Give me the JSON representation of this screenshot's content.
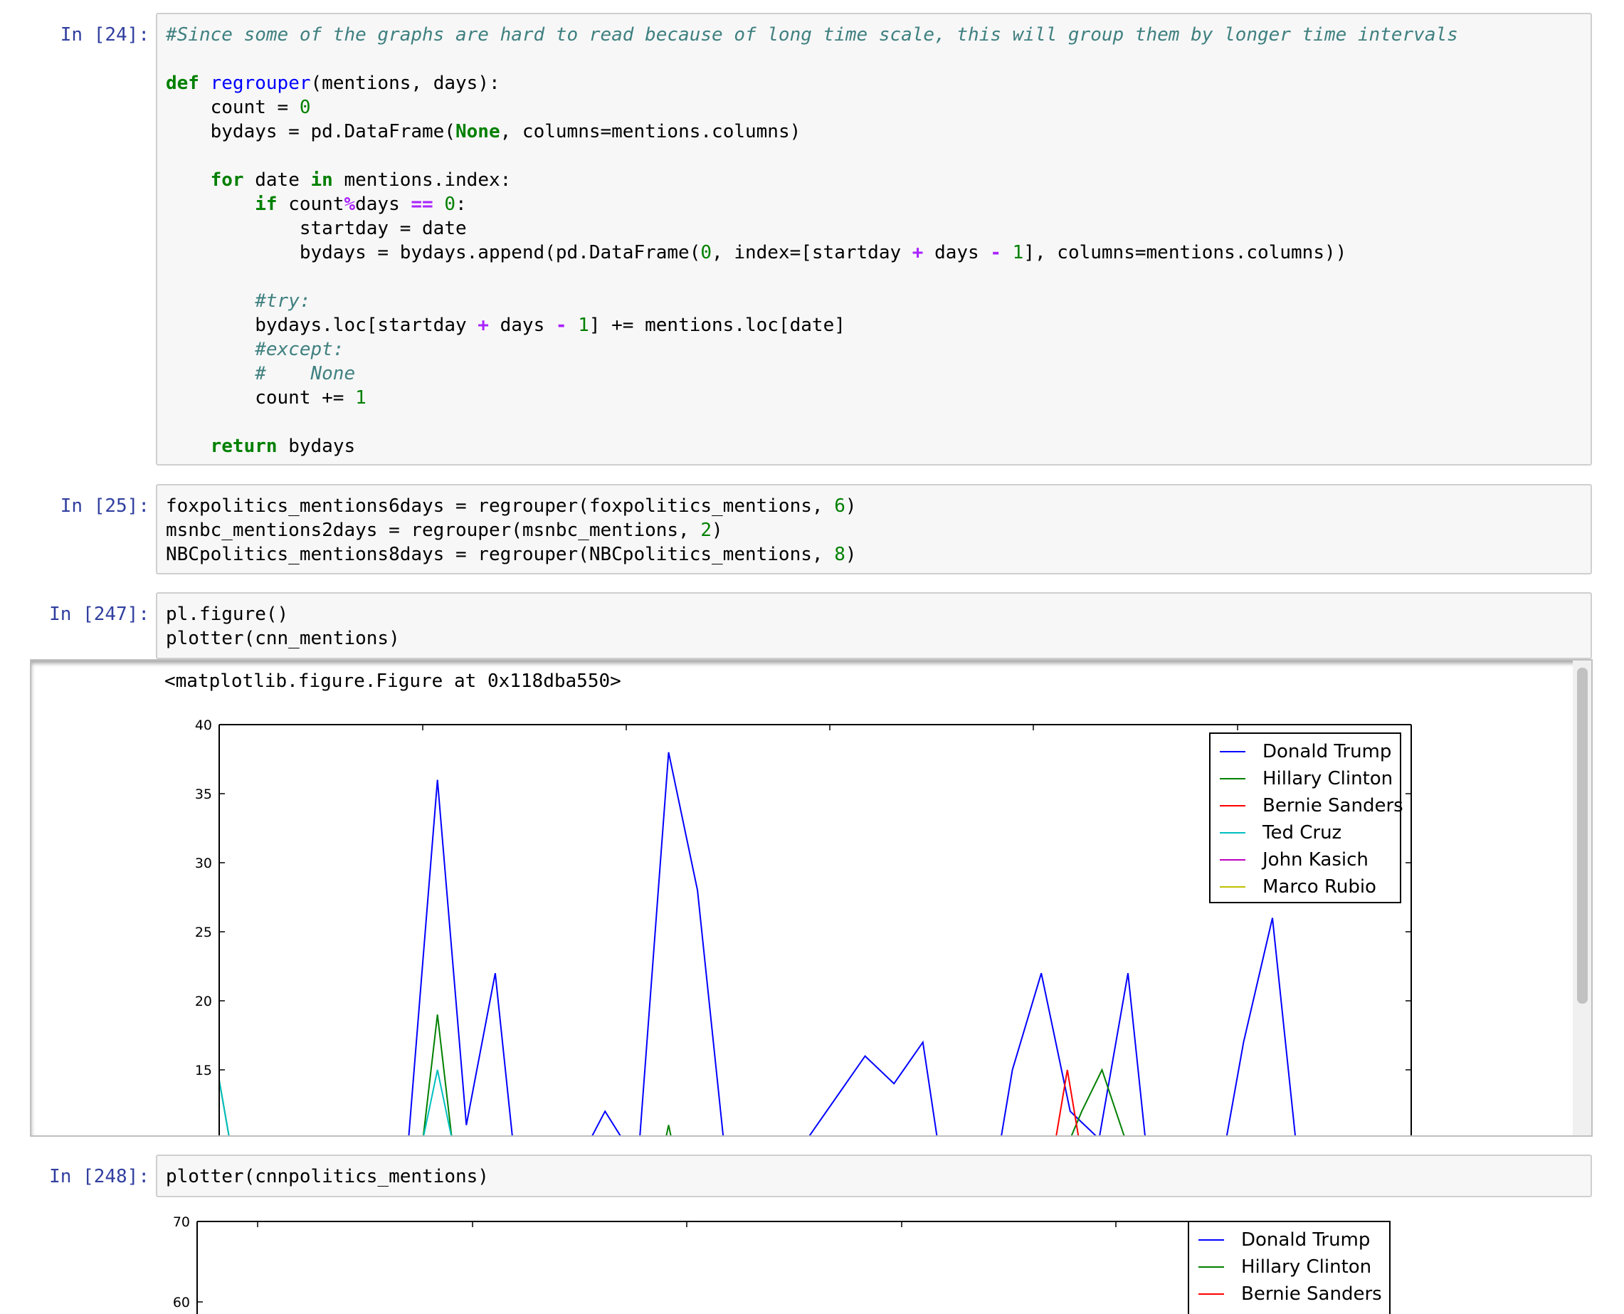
{
  "cells": {
    "c24": {
      "prompt": "In [24]:",
      "lines": [
        [
          [
            "cm",
            "#Since some of the graphs are hard to read because of long time scale, this will group them by longer time intervals"
          ]
        ],
        [],
        [
          [
            "kw",
            "def"
          ],
          [
            "t",
            " "
          ],
          [
            "fn",
            "regrouper"
          ],
          [
            "t",
            "(mentions, days):"
          ]
        ],
        [
          [
            "t",
            "    count = "
          ],
          [
            "num",
            "0"
          ]
        ],
        [
          [
            "t",
            "    bydays = pd.DataFrame("
          ],
          [
            "kw",
            "None"
          ],
          [
            "t",
            ", columns=mentions.columns)"
          ]
        ],
        [],
        [
          [
            "t",
            "    "
          ],
          [
            "kw",
            "for"
          ],
          [
            "t",
            " date "
          ],
          [
            "kw",
            "in"
          ],
          [
            "t",
            " mentions.index:"
          ]
        ],
        [
          [
            "t",
            "        "
          ],
          [
            "kw",
            "if"
          ],
          [
            "t",
            " count"
          ],
          [
            "op",
            "%"
          ],
          [
            "t",
            "days "
          ],
          [
            "op",
            "=="
          ],
          [
            "t",
            " "
          ],
          [
            "num",
            "0"
          ],
          [
            "t",
            ":"
          ]
        ],
        [
          [
            "t",
            "            startday = date"
          ]
        ],
        [
          [
            "t",
            "            bydays = bydays.append(pd.DataFrame("
          ],
          [
            "num",
            "0"
          ],
          [
            "t",
            ", index=[startday "
          ],
          [
            "op",
            "+"
          ],
          [
            "t",
            " days "
          ],
          [
            "op",
            "-"
          ],
          [
            "t",
            " "
          ],
          [
            "num",
            "1"
          ],
          [
            "t",
            "], columns=mentions.columns))"
          ]
        ],
        [],
        [
          [
            "t",
            "        "
          ],
          [
            "cm",
            "#try:"
          ]
        ],
        [
          [
            "t",
            "        bydays.loc[startday "
          ],
          [
            "op",
            "+"
          ],
          [
            "t",
            " days "
          ],
          [
            "op",
            "-"
          ],
          [
            "t",
            " "
          ],
          [
            "num",
            "1"
          ],
          [
            "t",
            "] += mentions.loc[date]"
          ]
        ],
        [
          [
            "t",
            "        "
          ],
          [
            "cm",
            "#except:"
          ]
        ],
        [
          [
            "t",
            "        "
          ],
          [
            "cm",
            "#    None"
          ]
        ],
        [
          [
            "t",
            "        count += "
          ],
          [
            "num",
            "1"
          ]
        ],
        [],
        [
          [
            "t",
            "    "
          ],
          [
            "kw",
            "return"
          ],
          [
            "t",
            " bydays"
          ]
        ]
      ]
    },
    "c25": {
      "prompt": "In [25]:",
      "lines": [
        [
          [
            "t",
            "foxpolitics_mentions6days = regrouper(foxpolitics_mentions, "
          ],
          [
            "num",
            "6"
          ],
          [
            "t",
            ")"
          ]
        ],
        [
          [
            "t",
            "msnbc_mentions2days = regrouper(msnbc_mentions, "
          ],
          [
            "num",
            "2"
          ],
          [
            "t",
            ")"
          ]
        ],
        [
          [
            "t",
            "NBCpolitics_mentions8days = regrouper(NBCpolitics_mentions, "
          ],
          [
            "num",
            "8"
          ],
          [
            "t",
            ")"
          ]
        ]
      ]
    },
    "c247": {
      "prompt": "In [247]:",
      "lines": [
        [
          [
            "t",
            "pl.figure()"
          ]
        ],
        [
          [
            "t",
            "plotter(cnn_mentions)"
          ]
        ]
      ],
      "output_text": "<matplotlib.figure.Figure at 0x118dba550>"
    },
    "c248": {
      "prompt": "In [248]:",
      "lines": [
        [
          [
            "t",
            "plotter(cnnpolitics_mentions)"
          ]
        ]
      ]
    }
  },
  "chart_data": [
    {
      "type": "line",
      "ylim": [
        10,
        40
      ],
      "yticks": [
        "40",
        "35",
        "30",
        "25",
        "20",
        "15"
      ],
      "grid": false,
      "legend": "top-right",
      "colors": {
        "Donald Trump": "#0000ff",
        "Hillary Clinton": "#008000",
        "Bernie Sanders": "#ff0000",
        "Ted Cruz": "#00bfbf",
        "John Kasich": "#bf00bf",
        "Marco Rubio": "#bfbf00"
      },
      "series": [
        {
          "name": "Donald Trump",
          "segments": [
            [
              [
                3.5,
                10
              ],
              [
                4.5,
                36
              ],
              [
                5.5,
                11
              ],
              [
                6.5,
                22
              ],
              [
                7.1,
                10
              ]
            ],
            [
              [
                9.8,
                10
              ],
              [
                10.3,
                12
              ],
              [
                10.9,
                10
              ]
            ],
            [
              [
                11.5,
                10
              ],
              [
                12.5,
                38
              ],
              [
                13.5,
                28
              ],
              [
                14.4,
                10
              ]
            ],
            [
              [
                17.3,
                10
              ],
              [
                18.3,
                13
              ],
              [
                19.3,
                16
              ],
              [
                20.3,
                14
              ],
              [
                21.3,
                17
              ],
              [
                21.8,
                10
              ]
            ],
            [
              [
                24,
                10
              ],
              [
                24.4,
                15
              ],
              [
                25.4,
                22
              ],
              [
                26.4,
                12
              ],
              [
                26.9,
                11
              ],
              [
                27.4,
                10
              ],
              [
                28.4,
                22
              ],
              [
                29,
                10
              ]
            ],
            [
              [
                31.8,
                10
              ],
              [
                32.4,
                17
              ],
              [
                33.4,
                26
              ],
              [
                34.2,
                10
              ]
            ]
          ]
        },
        {
          "name": "Hillary Clinton",
          "segments": [
            [
              [
                -3.7,
                10
              ],
              [
                -3.2,
                16
              ],
              [
                -2.7,
                10
              ]
            ],
            [
              [
                4,
                10
              ],
              [
                4.5,
                19
              ],
              [
                5,
                10
              ]
            ],
            [
              [
                12.4,
                10
              ],
              [
                12.5,
                11
              ],
              [
                12.6,
                10
              ]
            ],
            [
              [
                26.4,
                10
              ],
              [
                26.8,
                12
              ],
              [
                27.5,
                15
              ],
              [
                28.3,
                10
              ]
            ]
          ]
        },
        {
          "name": "Bernie Sanders",
          "segments": [
            [
              [
                25.9,
                10
              ],
              [
                26.3,
                15
              ],
              [
                26.7,
                10
              ]
            ]
          ]
        },
        {
          "name": "Ted Cruz",
          "segments": [
            [
              [
                -3.7,
                10
              ],
              [
                -3.2,
                16
              ],
              [
                -2.7,
                10
              ]
            ],
            [
              [
                4,
                10
              ],
              [
                4.5,
                15
              ],
              [
                5,
                10
              ]
            ]
          ]
        },
        {
          "name": "John Kasich",
          "segments": []
        },
        {
          "name": "Marco Rubio",
          "segments": []
        }
      ]
    },
    {
      "type": "line",
      "ylim": [
        60,
        70
      ],
      "yticks": [
        "70",
        "60"
      ],
      "grid": false,
      "legend": "top-right",
      "colors": {
        "Donald Trump": "#0000ff",
        "Hillary Clinton": "#008000",
        "Bernie Sanders": "#ff0000"
      },
      "series": [
        {
          "name": "Donald Trump",
          "segments": []
        },
        {
          "name": "Hillary Clinton",
          "segments": []
        },
        {
          "name": "Bernie Sanders",
          "segments": []
        }
      ]
    }
  ]
}
